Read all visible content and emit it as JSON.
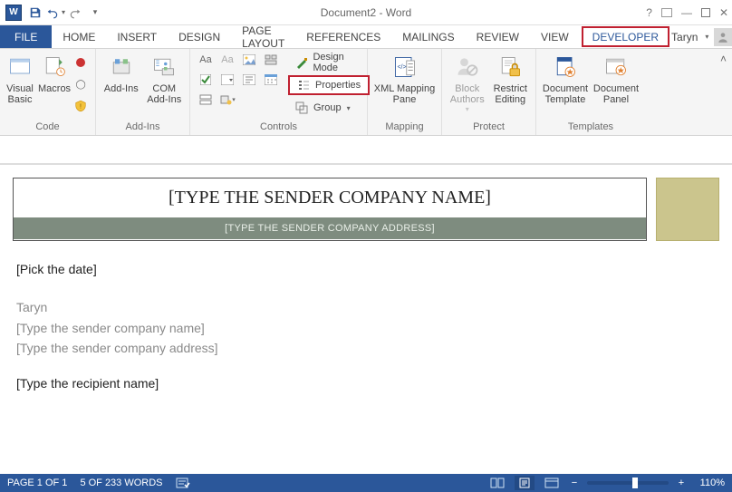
{
  "title": "Document2 - Word",
  "qat": {
    "undo_tip": "Undo",
    "redo_tip": "Redo",
    "save_tip": "Save"
  },
  "tabs": {
    "file": "FILE",
    "home": "HOME",
    "insert": "INSERT",
    "design": "DESIGN",
    "page_layout": "PAGE LAYOUT",
    "references": "REFERENCES",
    "mailings": "MAILINGS",
    "review": "REVIEW",
    "view": "VIEW",
    "developer": "DEVELOPER"
  },
  "user": {
    "name": "Taryn"
  },
  "ribbon": {
    "code": {
      "label": "Code",
      "visual_basic": "Visual\nBasic",
      "macros": "Macros"
    },
    "addins": {
      "label": "Add-Ins",
      "addins": "Add-Ins",
      "com": "COM\nAdd-Ins"
    },
    "controls": {
      "label": "Controls",
      "design_mode": "Design Mode",
      "properties": "Properties",
      "group": "Group"
    },
    "mapping": {
      "label": "Mapping",
      "xml": "XML Mapping\nPane"
    },
    "protect": {
      "label": "Protect",
      "block": "Block\nAuthors",
      "restrict": "Restrict\nEditing"
    },
    "templates": {
      "label": "Templates",
      "template": "Document\nTemplate",
      "panel": "Document\nPanel"
    }
  },
  "document": {
    "sender_company_ph": "[TYPE THE SENDER COMPANY NAME]",
    "sender_address_ph": "[TYPE THE SENDER COMPANY ADDRESS]",
    "pick_date": "[Pick the date]",
    "sender_name": "Taryn",
    "sender_company_inline": "[Type the sender company name]",
    "sender_address_inline": "[Type the sender company address]",
    "recipient_name": "[Type the recipient name]"
  },
  "status": {
    "page": "PAGE 1 OF 1",
    "words": "5 OF 233 WORDS",
    "zoom": "110%"
  }
}
